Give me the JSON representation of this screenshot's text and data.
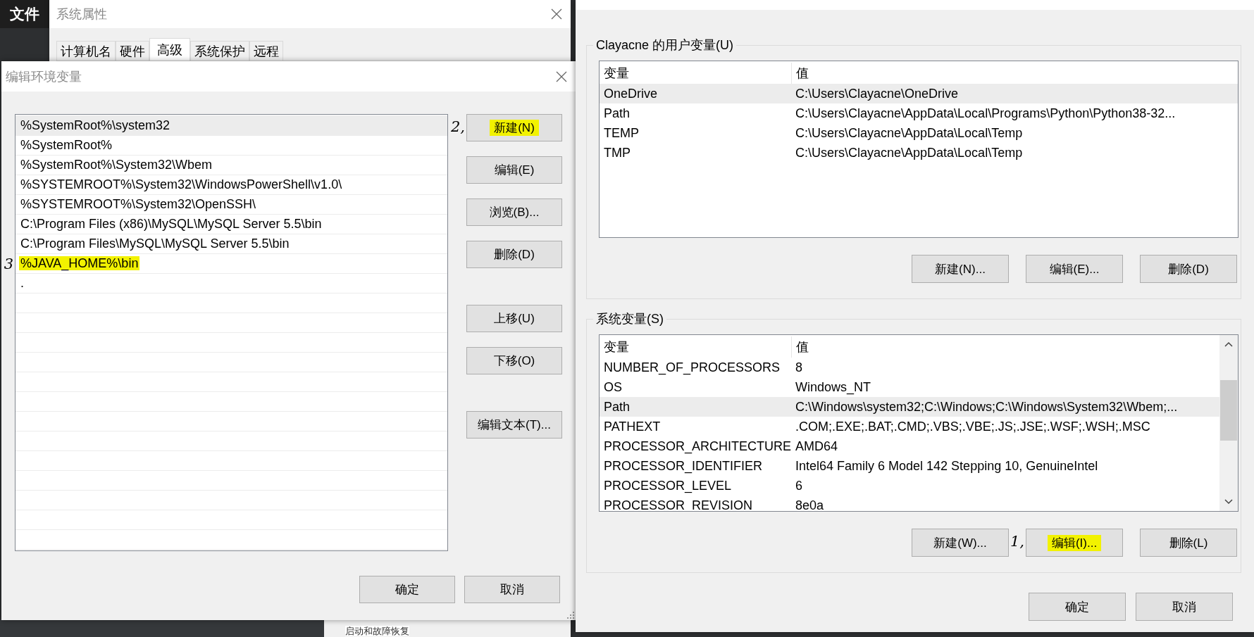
{
  "background_app": {
    "menu_label": "文件"
  },
  "system_properties": {
    "title": "系统属性",
    "tabs": [
      {
        "label": "计算机名",
        "selected": false
      },
      {
        "label": "硬件",
        "selected": false
      },
      {
        "label": "高级",
        "selected": true
      },
      {
        "label": "系统保护",
        "selected": false
      },
      {
        "label": "远程",
        "selected": false
      }
    ],
    "group_label": "启动和故障恢复"
  },
  "edit_dialog": {
    "title": "编辑环境变量",
    "entries": [
      {
        "text": "%SystemRoot%\\system32",
        "selected": true,
        "highlighted": false
      },
      {
        "text": "%SystemRoot%",
        "selected": false,
        "highlighted": false
      },
      {
        "text": "%SystemRoot%\\System32\\Wbem",
        "selected": false,
        "highlighted": false
      },
      {
        "text": "%SYSTEMROOT%\\System32\\WindowsPowerShell\\v1.0\\",
        "selected": false,
        "highlighted": false
      },
      {
        "text": "%SYSTEMROOT%\\System32\\OpenSSH\\",
        "selected": false,
        "highlighted": false
      },
      {
        "text": "C:\\Program Files (x86)\\MySQL\\MySQL Server 5.5\\bin",
        "selected": false,
        "highlighted": false
      },
      {
        "text": "C:\\Program Files\\MySQL\\MySQL Server 5.5\\bin",
        "selected": false,
        "highlighted": false
      },
      {
        "text": "%JAVA_HOME%\\bin",
        "selected": false,
        "highlighted": true,
        "annotation": "3"
      },
      {
        "text": ".",
        "selected": false,
        "highlighted": false
      }
    ],
    "button_groups": [
      [
        {
          "label": "新建(N)",
          "highlighted": true,
          "annotation": "2,"
        },
        {
          "label": "编辑(E)",
          "highlighted": false
        },
        {
          "label": "浏览(B)...",
          "highlighted": false
        },
        {
          "label": "删除(D)",
          "highlighted": false
        }
      ],
      [
        {
          "label": "上移(U)",
          "highlighted": false
        },
        {
          "label": "下移(O)",
          "highlighted": false
        }
      ],
      [
        {
          "label": "编辑文本(T)...",
          "highlighted": false
        }
      ]
    ],
    "footer_buttons": [
      "确定",
      "取消"
    ]
  },
  "environment_variables": {
    "groups": [
      {
        "label": "Clayacne 的用户变量(U)",
        "columns": [
          "变量",
          "值"
        ],
        "scrollbar": false,
        "rows": [
          {
            "name": "OneDrive",
            "value": "C:\\Users\\Clayacne\\OneDrive",
            "selected": true
          },
          {
            "name": "Path",
            "value": "C:\\Users\\Clayacne\\AppData\\Local\\Programs\\Python\\Python38-32...",
            "selected": false
          },
          {
            "name": "TEMP",
            "value": "C:\\Users\\Clayacne\\AppData\\Local\\Temp",
            "selected": false
          },
          {
            "name": "TMP",
            "value": "C:\\Users\\Clayacne\\AppData\\Local\\Temp",
            "selected": false
          }
        ],
        "buttons": [
          {
            "label": "新建(N)...",
            "highlighted": false
          },
          {
            "label": "编辑(E)...",
            "highlighted": false
          },
          {
            "label": "删除(D)",
            "highlighted": false
          }
        ]
      },
      {
        "label": "系统变量(S)",
        "columns": [
          "变量",
          "值"
        ],
        "scrollbar": true,
        "rows": [
          {
            "name": "NUMBER_OF_PROCESSORS",
            "value": "8",
            "selected": false
          },
          {
            "name": "OS",
            "value": "Windows_NT",
            "selected": false
          },
          {
            "name": "Path",
            "value": "C:\\Windows\\system32;C:\\Windows;C:\\Windows\\System32\\Wbem;...",
            "selected": true
          },
          {
            "name": "PATHEXT",
            "value": ".COM;.EXE;.BAT;.CMD;.VBS;.VBE;.JS;.JSE;.WSF;.WSH;.MSC",
            "selected": false
          },
          {
            "name": "PROCESSOR_ARCHITECTURE",
            "value": "AMD64",
            "selected": false
          },
          {
            "name": "PROCESSOR_IDENTIFIER",
            "value": "Intel64 Family 6 Model 142 Stepping 10, GenuineIntel",
            "selected": false
          },
          {
            "name": "PROCESSOR_LEVEL",
            "value": "6",
            "selected": false
          },
          {
            "name": "PROCESSOR_REVISION",
            "value": "8e0a",
            "selected": false
          }
        ],
        "buttons": [
          {
            "label": "新建(W)...",
            "highlighted": false
          },
          {
            "label": "编辑(I)...",
            "highlighted": true,
            "annotation": "1,"
          },
          {
            "label": "删除(L)",
            "highlighted": false
          }
        ]
      }
    ],
    "footer_buttons": [
      "确定",
      "取消"
    ]
  }
}
